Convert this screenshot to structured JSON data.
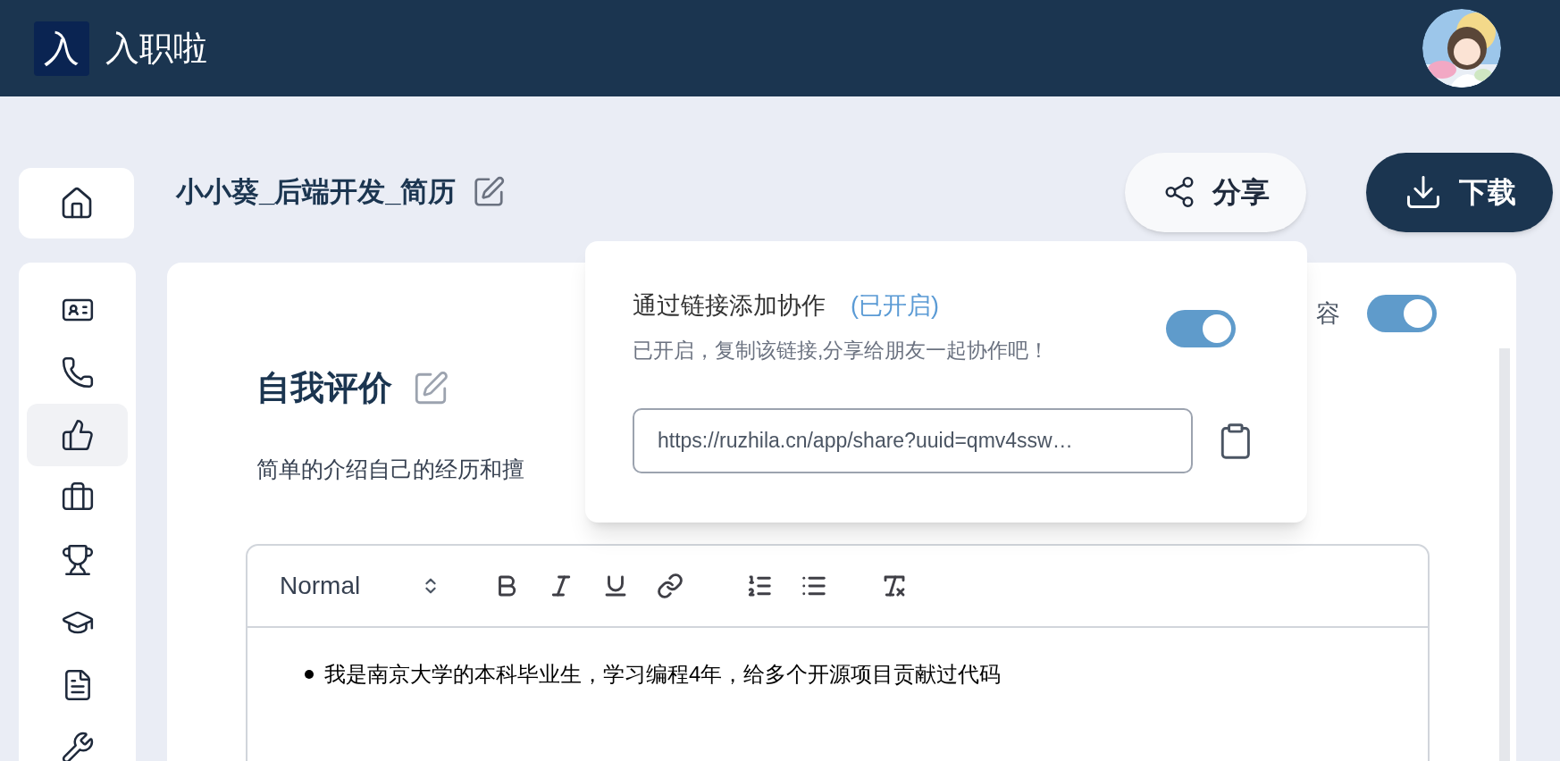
{
  "app": {
    "logo_mark": "入",
    "name": "入职啦"
  },
  "sidebar": {
    "home": {
      "kind": "home",
      "selected": false
    },
    "items": [
      {
        "kind": "profile",
        "selected": false
      },
      {
        "kind": "phone",
        "selected": false
      },
      {
        "kind": "thumbs-up",
        "selected": true
      },
      {
        "kind": "briefcase",
        "selected": false
      },
      {
        "kind": "trophy",
        "selected": false
      },
      {
        "kind": "education",
        "selected": false
      },
      {
        "kind": "document",
        "selected": false
      },
      {
        "kind": "tools",
        "selected": false
      }
    ]
  },
  "document": {
    "title": "小小葵_后端开发_简历"
  },
  "actions": [
    {
      "kind": "share",
      "label": "分享"
    },
    {
      "kind": "download",
      "label": "下载"
    }
  ],
  "section": {
    "toggle_label": "容",
    "toggle_on": true,
    "heading": "自我评价",
    "description": "简单的介绍自己的经历和擅"
  },
  "editor": {
    "format": "Normal",
    "tools": [
      {
        "kind": "bold"
      },
      {
        "kind": "italic"
      },
      {
        "kind": "underline"
      },
      {
        "kind": "link"
      },
      {
        "kind": "ordered-list"
      },
      {
        "kind": "bullet-list"
      },
      {
        "kind": "clear-format"
      }
    ],
    "bullets": [
      "我是南京大学的本科毕业生，学习编程4年，给多个开源项目贡献过代码"
    ]
  },
  "share_popover": {
    "title": "通过链接添加协作",
    "status": "(已开启)",
    "on": true,
    "hint": "已开启，复制该链接,分享给朋友一起协作吧！",
    "link": "https://ruzhila.cn/app/share?uuid=qmv4ssw…"
  }
}
